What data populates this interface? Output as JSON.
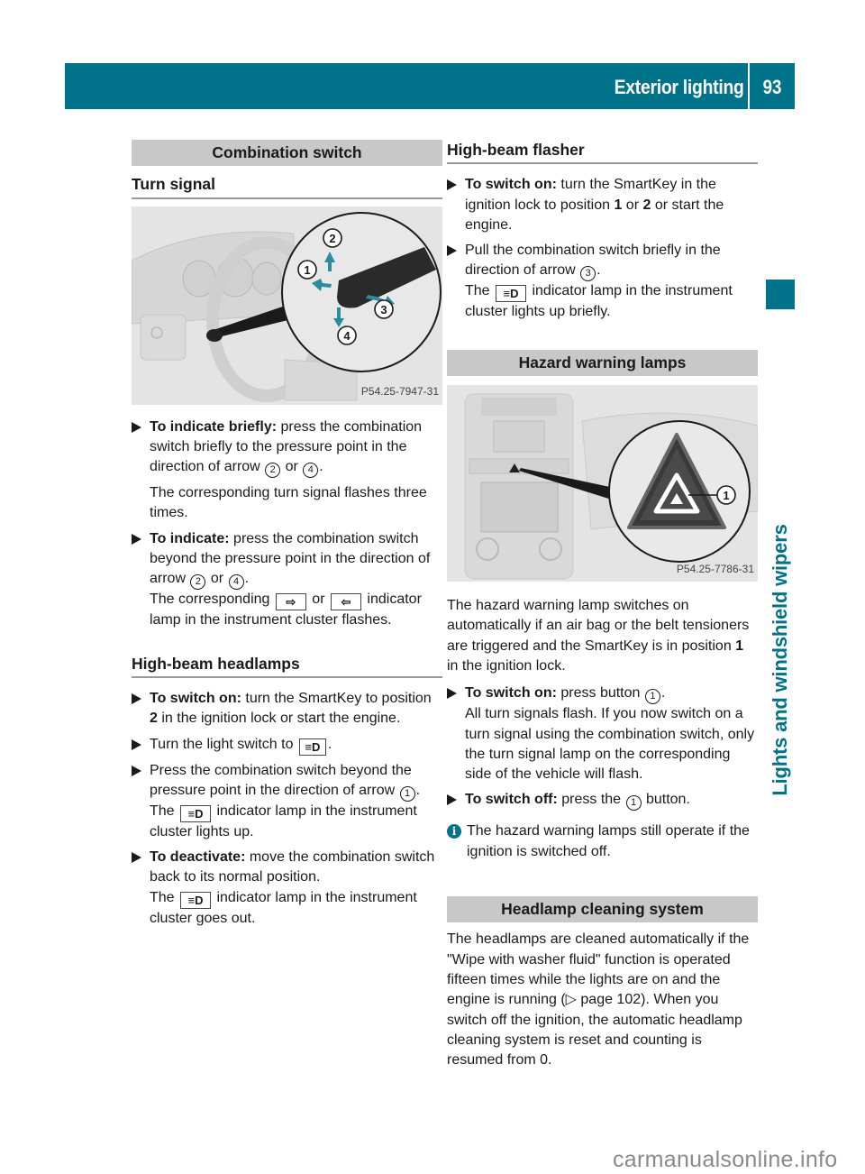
{
  "header": {
    "title": "Exterior lighting",
    "page_number": "93"
  },
  "side_tab": {
    "label": "Lights and windshield wipers"
  },
  "left": {
    "section_title": "Combination switch",
    "turn_signal": {
      "heading": "Turn signal",
      "figure_code": "P54.25-7947-31",
      "figure_callouts": [
        "1",
        "2",
        "3",
        "4"
      ],
      "steps": [
        {
          "bold": "To indicate briefly:",
          "text": " press the combination switch briefly to the pressure point in the direction of arrow ",
          "ref1": "2",
          "mid": " or ",
          "ref2": "4",
          "end": ".",
          "note": "The corresponding turn signal flashes three times."
        },
        {
          "bold": "To indicate:",
          "text": " press the combination switch beyond the pressure point in the direction of arrow ",
          "ref1": "2",
          "mid": " or ",
          "ref2": "4",
          "end": ".",
          "note_pre": "The corresponding ",
          "icon1": "right-turn-indicator-icon",
          "note_mid": " or ",
          "icon2": "left-turn-indicator-icon",
          "note_post": " indicator lamp in the instrument cluster flashes."
        }
      ]
    },
    "high_beam": {
      "heading": "High-beam headlamps",
      "steps": [
        {
          "bold": "To switch on:",
          "text_pre": " turn the SmartKey to position ",
          "bold_num": "2",
          "text_post": " in the ignition lock or start the engine."
        },
        {
          "text": "Turn the light switch to ",
          "icon": "low-beam-icon",
          "end": "."
        },
        {
          "text": "Press the combination switch beyond the pressure point in the direction of arrow ",
          "ref": "1",
          "end": ".",
          "note_pre": "The ",
          "icon": "high-beam-icon",
          "note_post": " indicator lamp in the instrument cluster lights up."
        },
        {
          "bold": "To deactivate:",
          "text": " move the combination switch back to its normal position.",
          "note_pre": "The ",
          "icon": "high-beam-icon",
          "note_post": " indicator lamp in the instrument cluster goes out."
        }
      ]
    }
  },
  "right": {
    "flasher": {
      "heading": "High-beam flasher",
      "steps": [
        {
          "bold": "To switch on:",
          "text_pre": " turn the SmartKey in the ignition lock to position ",
          "n1": "1",
          "mid": " or ",
          "n2": "2",
          "text_post": " or start the engine."
        },
        {
          "text": "Pull the combination switch briefly in the direction of arrow ",
          "ref": "3",
          "end": ".",
          "note_pre": "The ",
          "icon": "high-beam-icon",
          "note_post": " indicator lamp in the instrument cluster lights up briefly."
        }
      ]
    },
    "hazard": {
      "section_title": "Hazard warning lamps",
      "figure_code": "P54.25-7786-31",
      "figure_callout": "1",
      "intro_pre": "The hazard warning lamp switches on automatically if an air bag or the belt tensioners are triggered and the SmartKey is in position ",
      "intro_num": "1",
      "intro_post": " in the ignition lock.",
      "steps": [
        {
          "bold": "To switch on:",
          "text": " press button ",
          "ref": "1",
          "end": ".",
          "note": "All turn signals flash. If you now switch on a turn signal using the combination switch, only the turn signal lamp on the corresponding side of the vehicle will flash."
        },
        {
          "bold": "To switch off:",
          "text": " press the ",
          "ref": "1",
          "end": " button."
        }
      ],
      "info_note": "The hazard warning lamps still operate if the ignition is switched off."
    },
    "cleaning": {
      "section_title": "Headlamp cleaning system",
      "text_pre": "The headlamps are cleaned automatically if the \"Wipe with washer fluid\" function is operated fifteen times while the lights are on and the engine is running (",
      "page_ref": "▷ page 102",
      "text_post": "). When you switch off the ignition, the automatic headlamp cleaning system is reset and counting is resumed from 0."
    }
  },
  "watermark": "carmanualsonline.info",
  "colors": {
    "brand": "#007289",
    "section_bg": "#c8c8c8",
    "arrow": "#2a8c9c"
  }
}
